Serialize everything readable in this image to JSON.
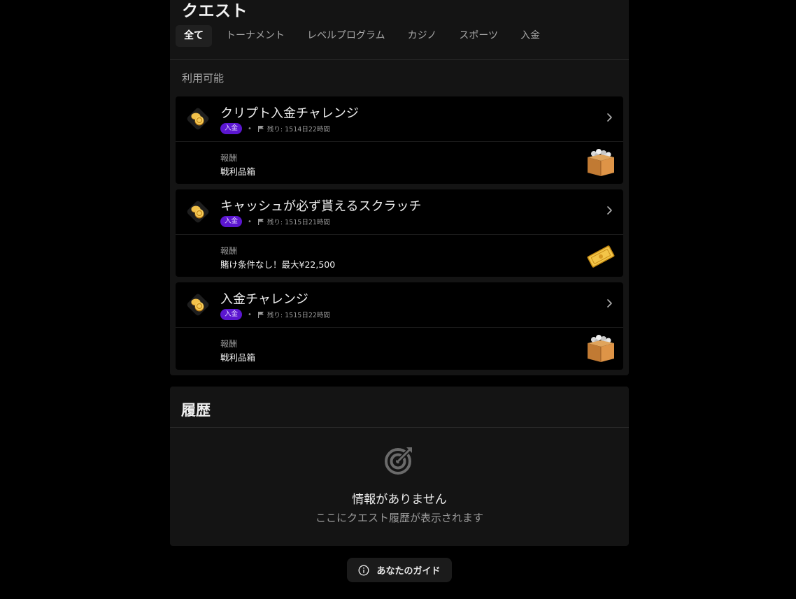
{
  "quests": {
    "title": "クエスト",
    "tabs": [
      {
        "label": "全て",
        "active": true
      },
      {
        "label": "トーナメント"
      },
      {
        "label": "レベルプログラム"
      },
      {
        "label": "カジノ"
      },
      {
        "label": "スポーツ"
      },
      {
        "label": "入金"
      }
    ],
    "available_label": "利用可能",
    "reward_label": "報酬",
    "cards": [
      {
        "title": "クリプト入金チャレンジ",
        "badge": "入金",
        "remaining": "残り: 1514日22時間",
        "reward": "戦利品箱",
        "reward_icon": "loot-box-icon",
        "quest_icon": "coins-icon"
      },
      {
        "title": "キャッシュが必ず貰えるスクラッチ",
        "badge": "入金",
        "remaining": "残り: 1515日21時間",
        "reward": "賭け条件なし！最大¥22,500",
        "reward_icon": "golden-ticket-icon",
        "quest_icon": "coins-icon"
      },
      {
        "title": "入金チャレンジ",
        "badge": "入金",
        "remaining": "残り: 1515日22時間",
        "reward": "戦利品箱",
        "reward_icon": "loot-box-icon",
        "quest_icon": "coins-icon"
      }
    ]
  },
  "history": {
    "title": "履歴",
    "empty_icon": "target-icon",
    "empty_title": "情報がありません",
    "empty_subtitle": "ここにクエスト履歴が表示されます"
  },
  "guide": {
    "label": "あなたのガイド",
    "icon": "info-icon"
  },
  "colors": {
    "background": "#000000",
    "panel": "#141414",
    "badge": "#5b16d0",
    "gold": "#e2a62b"
  }
}
